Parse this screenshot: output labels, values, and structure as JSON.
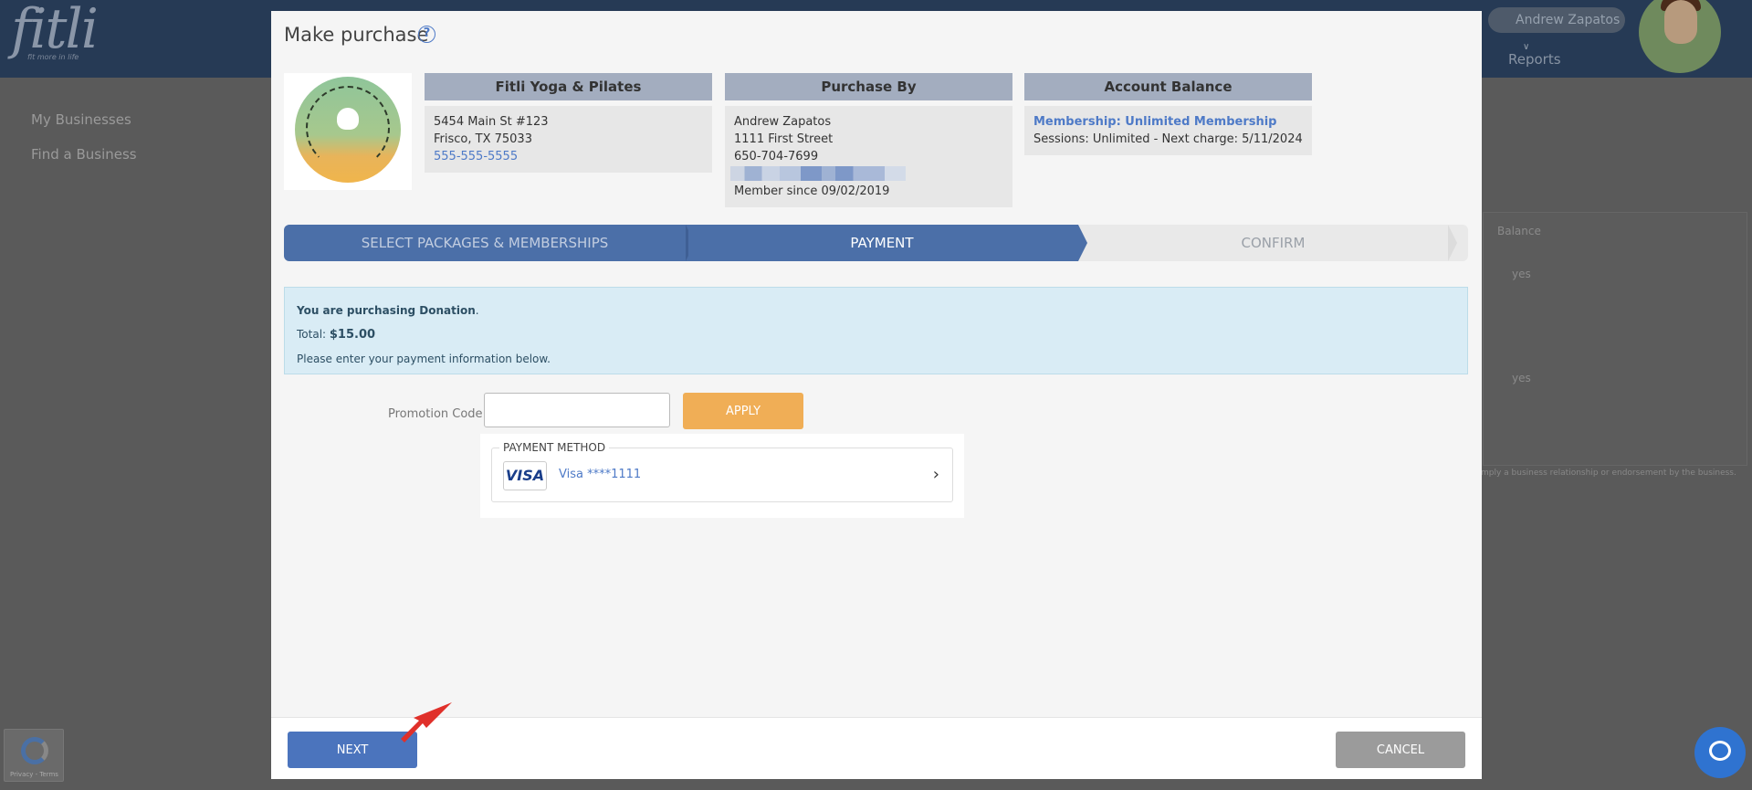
{
  "background": {
    "logo": "fitli",
    "logo_tagline": "fit more in life",
    "user_name": "Andrew Zapatos",
    "user_chevron": "∨",
    "header_link": "Reports",
    "sidebar": [
      "My Businesses",
      "Find a Business"
    ],
    "table_header": "Balance",
    "table_values": [
      "yes",
      "yes"
    ],
    "footnote": "mply a business relationship or endorsement by the business.",
    "recaptcha_text": "Privacy - Terms"
  },
  "modal": {
    "title": "Make purchase",
    "help_icon": "?",
    "business": {
      "name": "Fitli Yoga & Pilates",
      "address1": "5454 Main St #123",
      "address2": "Frisco, TX 75033",
      "phone": "555-555-5555"
    },
    "purchaser": {
      "header": "Purchase By",
      "name": "Andrew Zapatos",
      "street": "1111 First Street",
      "phone": "650-704-7699",
      "member_since": "Member since 09/02/2019"
    },
    "account": {
      "header": "Account Balance",
      "membership": "Membership: Unlimited Membership",
      "sessions": "Sessions: Unlimited -  Next charge: 5/11/2024"
    },
    "steps": [
      "SELECT PACKAGES & MEMBERSHIPS",
      "PAYMENT",
      "CONFIRM"
    ],
    "alert": {
      "prefix": "You are purchasing Donation",
      "suffix": ".",
      "total_label": "Total: ",
      "total_value": "$15.00",
      "instruction": "Please enter your payment information below."
    },
    "promo": {
      "label": "Promotion Code",
      "value": "",
      "apply_label": "APPLY"
    },
    "payment_method": {
      "legend": "PAYMENT METHOD",
      "card_brand": "VISA",
      "card_text": "Visa ****1111",
      "chevron": "›"
    },
    "footer": {
      "next_label": "NEXT",
      "cancel_label": "CANCEL"
    }
  },
  "colors": {
    "primary": "#4b6fa8",
    "apply": "#f0ae56",
    "cancel": "#9b9b9b",
    "link": "#4e7ac7",
    "alert_bg": "#d9ecf5"
  }
}
